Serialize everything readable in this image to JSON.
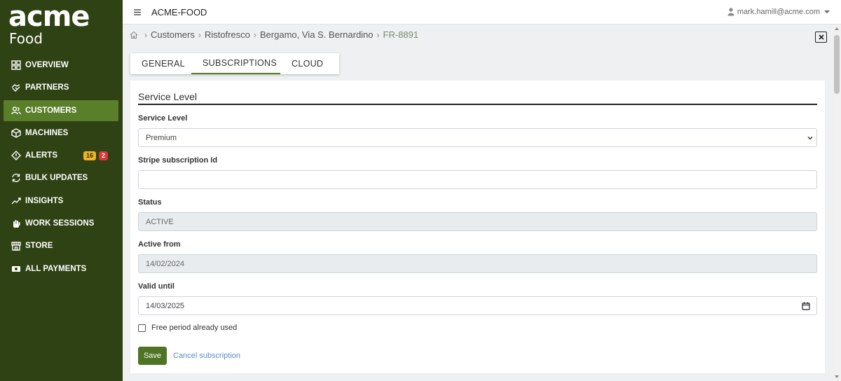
{
  "brand": {
    "name": "acme",
    "sub": "Food"
  },
  "sidebar": {
    "items": [
      {
        "label": "OVERVIEW",
        "icon": "grid-icon"
      },
      {
        "label": "PARTNERS",
        "icon": "handshake-icon"
      },
      {
        "label": "CUSTOMERS",
        "icon": "users-icon",
        "active": true
      },
      {
        "label": "MACHINES",
        "icon": "box-icon"
      },
      {
        "label": "ALERTS",
        "icon": "diamond-alert-icon",
        "badge_warning": "16",
        "badge_danger": "2"
      },
      {
        "label": "BULK UPDATES",
        "icon": "refresh-icon"
      },
      {
        "label": "INSIGHTS",
        "icon": "trend-icon"
      },
      {
        "label": "WORK SESSIONS",
        "icon": "hand-icon"
      },
      {
        "label": "STORE",
        "icon": "store-icon"
      },
      {
        "label": "ALL PAYMENTS",
        "icon": "money-icon"
      }
    ]
  },
  "header": {
    "title": "ACME-FOOD",
    "user": "mark.hamill@acme.com"
  },
  "breadcrumb": {
    "items": [
      "Customers",
      "Ristofresco",
      "Bergamo, Via S. Bernardino"
    ],
    "current": "FR-8891"
  },
  "tabs": [
    {
      "label": "GENERAL"
    },
    {
      "label": "SUBSCRIPTIONS",
      "active": true
    },
    {
      "label": "CLOUD"
    }
  ],
  "form": {
    "section_title": "Service Level",
    "service_level": {
      "label": "Service Level",
      "value": "Premium"
    },
    "stripe_id": {
      "label": "Stripe subscription Id",
      "value": ""
    },
    "status": {
      "label": "Status",
      "value": "ACTIVE"
    },
    "active_from": {
      "label": "Active from",
      "value": "14/02/2024"
    },
    "valid_until": {
      "label": "Valid until",
      "value": "14/03/2025"
    },
    "free_period": {
      "label": "Free period already used",
      "checked": false
    },
    "save_label": "Save",
    "cancel_label": "Cancel subscription"
  },
  "colors": {
    "sidebar_bg": "#2e4213",
    "active_nav": "#5a7f2a",
    "save_button": "#4f7424",
    "link": "#5b8bc9"
  }
}
